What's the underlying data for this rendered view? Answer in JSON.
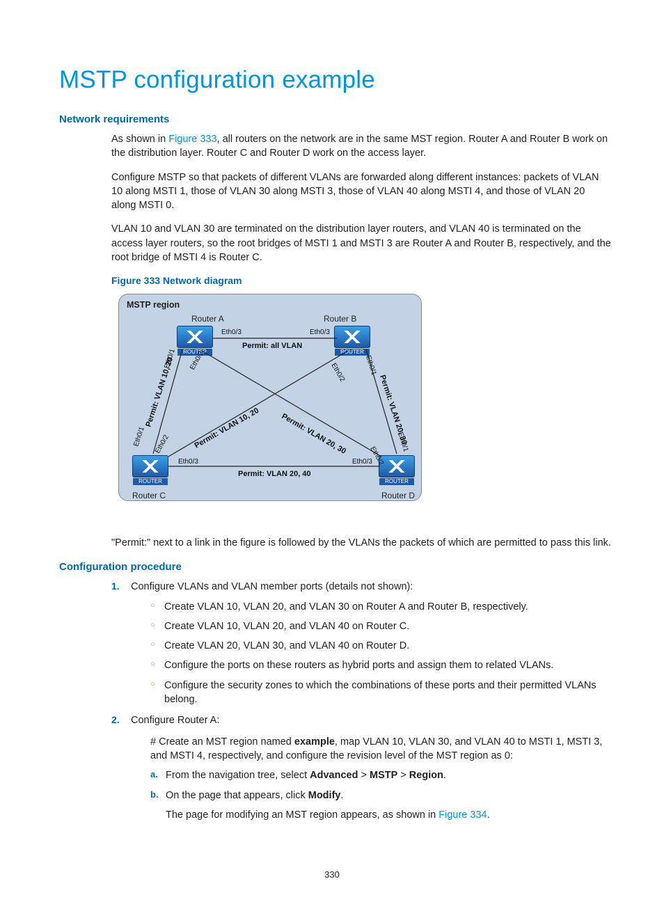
{
  "title": "MSTP configuration example",
  "h_net_req": "Network requirements",
  "p1_a": "As shown in ",
  "p1_link": "Figure 333",
  "p1_b": ", all routers on the network are in the same MST region. Router A and Router B work on the distribution layer. Router C and Router D work on the access layer.",
  "p2": "Configure MSTP so that packets of different VLANs are forwarded along different instances: packets of VLAN 10 along MSTI 1, those of VLAN 30 along MSTI 3, those of VLAN 40 along MSTI 4, and those of VLAN 20 along MSTI 0.",
  "p3": "VLAN 10 and VLAN 30 are terminated on the distribution layer routers, and VLAN 40 is terminated on the access layer routers, so the root bridges of MSTI 1 and MSTI 3 are Router A and Router B, respectively, and the root bridge of MSTI 4 is Router C.",
  "fig_caption": "Figure 333 Network diagram",
  "diagram": {
    "region_title": "MSTP region",
    "router_a": "Router A",
    "router_b": "Router B",
    "router_c": "Router C",
    "router_d": "Router D",
    "router_tag": "ROUTER",
    "eth01": "Eth0/1",
    "eth02": "Eth0/2",
    "eth03": "Eth0/3",
    "permit_all": "Permit: all VLAN",
    "permit_1020": "Permit: VLAN 10, 20",
    "permit_2030": "Permit: VLAN 20, 30",
    "permit_1020_diag": "Permit: VLAN 10, 20",
    "permit_2030_diag": "Permit: VLAN 20, 30",
    "permit_2040": "Permit: VLAN 20, 40"
  },
  "p4": "\"Permit:\" next to a link in the figure is followed by the VLANs the packets of which are permitted to pass this link.",
  "h_cfg": "Configuration procedure",
  "steps": {
    "s1": {
      "num": "1.",
      "text": "Configure VLANs and VLAN member ports (details not shown):",
      "bullets": [
        "Create VLAN 10, VLAN 20, and VLAN 30 on Router A and Router B, respectively.",
        "Create VLAN 10, VLAN 20, and VLAN 40 on Router C.",
        "Create VLAN 20, VLAN 30, and VLAN 40 on Router D.",
        "Configure the ports on these routers as hybrid ports and assign them to related VLANs.",
        "Configure the security zones to which the combinations of these ports and their permitted VLANs belong."
      ]
    },
    "s2": {
      "num": "2.",
      "text": "Configure Router A:",
      "desc_a": "# Create an MST region named ",
      "desc_bold": "example",
      "desc_b": ", map VLAN 10, VLAN 30, and VLAN 40 to MSTI 1, MSTI 3, and MSTI 4, respectively, and configure the revision level of the MST region as 0:",
      "sub": {
        "a_let": "a.",
        "a_pre": "From the navigation tree, select ",
        "a_b1": "Advanced",
        "a_s1": " > ",
        "a_b2": "MSTP",
        "a_s2": " > ",
        "a_b3": "Region",
        "a_end": ".",
        "b_let": "b.",
        "b_pre": "On the page that appears, click ",
        "b_bold": "Modify",
        "b_end": ".",
        "b_line2_a": "The page for modifying an MST region appears, as shown in ",
        "b_line2_link": "Figure 334",
        "b_line2_b": "."
      }
    }
  },
  "page_num": "330"
}
